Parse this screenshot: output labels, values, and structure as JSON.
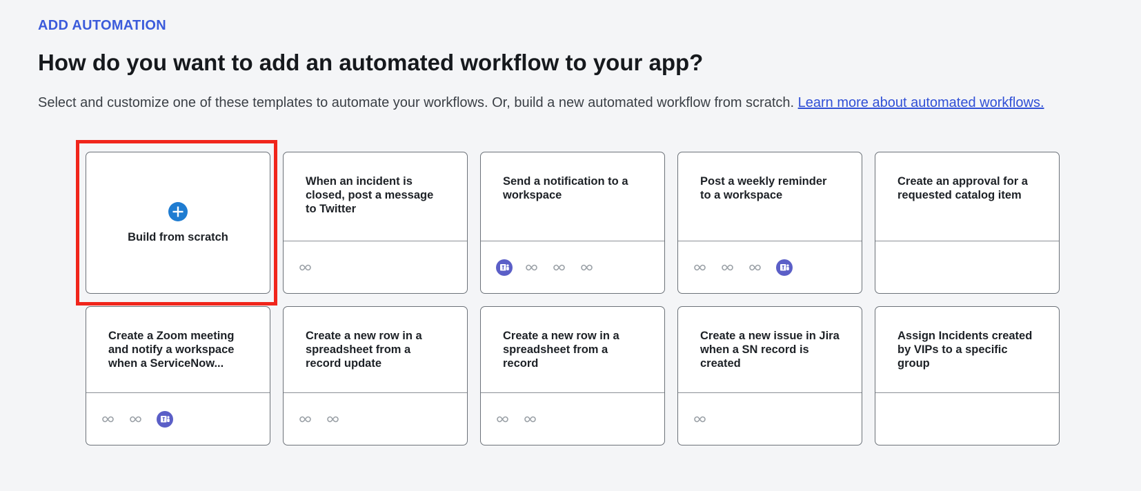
{
  "header": {
    "eyebrow": "ADD AUTOMATION",
    "title": "How do you want to add an automated workflow to your app?",
    "subtitle": "Select and customize one of these templates to automate your workflows. Or, build a new automated workflow from scratch. ",
    "learn_more_link": "Learn more about automated workflows."
  },
  "scratch_card": {
    "label": "Build from scratch",
    "icon": "plus-circle-icon",
    "accent": "#1f7cd1"
  },
  "highlight_color": "#f0251b",
  "templates": [
    {
      "title": "When an incident is closed, post a message to Twitter",
      "icons": [
        "infinity-icon"
      ]
    },
    {
      "title": "Send a notification to a workspace",
      "icons": [
        "teams-icon",
        "infinity-icon",
        "infinity-icon",
        "infinity-icon"
      ]
    },
    {
      "title": "Post a weekly reminder to a workspace",
      "icons": [
        "infinity-icon",
        "infinity-icon",
        "infinity-icon",
        "teams-icon"
      ]
    },
    {
      "title": "Create an approval for a requested catalog item",
      "icons": []
    },
    {
      "title": "Create a Zoom meeting and notify a workspace when a ServiceNow...",
      "icons": [
        "infinity-icon",
        "infinity-icon",
        "teams-icon"
      ]
    },
    {
      "title": "Create a new row in a spreadsheet from a record update",
      "icons": [
        "infinity-icon",
        "infinity-icon"
      ]
    },
    {
      "title": "Create a new row in a spreadsheet from a record",
      "icons": [
        "infinity-icon",
        "infinity-icon"
      ]
    },
    {
      "title": "Create a new issue in Jira when a SN record is created",
      "icons": [
        "infinity-icon"
      ]
    },
    {
      "title": "Assign Incidents created by VIPs to a specific group",
      "icons": []
    }
  ],
  "colors": {
    "teams": "#5b5fc7",
    "infinity": "#9aa0a6",
    "link": "#2f4fd6"
  }
}
